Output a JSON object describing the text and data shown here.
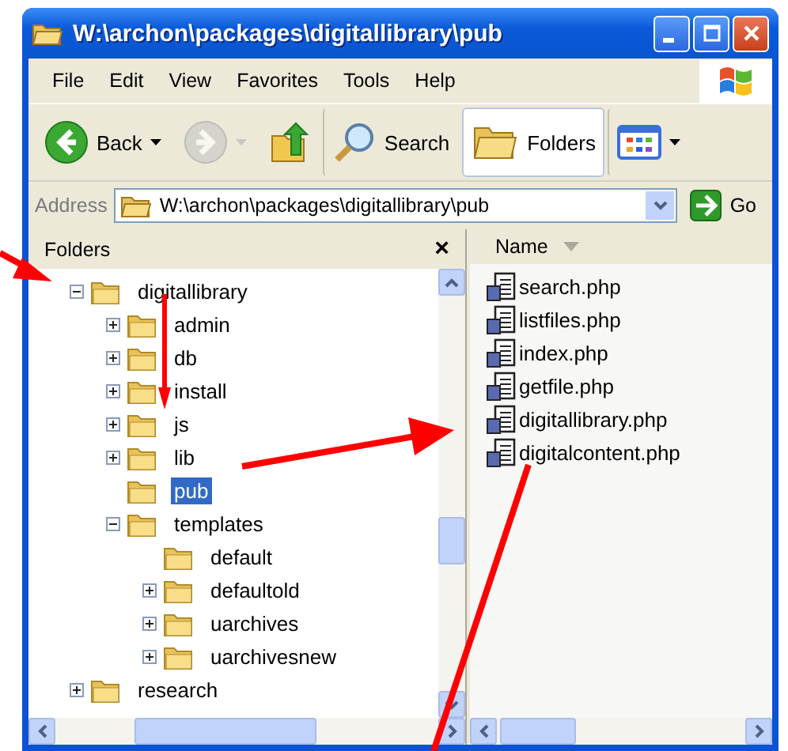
{
  "window": {
    "title": "W:\\archon\\packages\\digitallibrary\\pub"
  },
  "menu": [
    "File",
    "Edit",
    "View",
    "Favorites",
    "Tools",
    "Help"
  ],
  "toolbar": [
    {
      "kind": "back",
      "label": "Back",
      "pressed": false,
      "disabled": false
    },
    {
      "kind": "forward",
      "pressed": false,
      "disabled": true
    },
    {
      "kind": "up",
      "pressed": false,
      "disabled": false
    },
    {
      "kind": "search",
      "label": "Search",
      "pressed": false,
      "disabled": false
    },
    {
      "kind": "folders",
      "label": "Folders",
      "pressed": true,
      "disabled": false
    },
    {
      "kind": "views",
      "pressed": false,
      "disabled": false
    }
  ],
  "address": {
    "label": "Address",
    "value": "W:\\archon\\packages\\digitallibrary\\pub",
    "go": "Go"
  },
  "folders_pane": {
    "title": "Folders",
    "close": "×",
    "tree": [
      {
        "label": "digitallibrary",
        "expanded": true,
        "selected": false,
        "children": [
          {
            "label": "admin",
            "expanded": false,
            "selected": false
          },
          {
            "label": "db",
            "expanded": false,
            "selected": false
          },
          {
            "label": "install",
            "expanded": false,
            "selected": false
          },
          {
            "label": "js",
            "expanded": false,
            "selected": false
          },
          {
            "label": "lib",
            "expanded": false,
            "selected": false
          },
          {
            "label": "pub",
            "selected": true
          },
          {
            "label": "templates",
            "expanded": true,
            "selected": false,
            "children": [
              {
                "label": "default",
                "selected": false
              },
              {
                "label": "defaultold",
                "expanded": false,
                "selected": false
              },
              {
                "label": "uarchives",
                "expanded": false,
                "selected": false
              },
              {
                "label": "uarchivesnew",
                "expanded": false,
                "selected": false
              }
            ]
          }
        ]
      },
      {
        "label": "research",
        "expanded": false,
        "selected": false
      }
    ]
  },
  "file_list": {
    "columns": [
      "Name"
    ],
    "files": [
      "search.php",
      "listfiles.php",
      "index.php",
      "getfile.php",
      "digitallibrary.php",
      "digitalcontent.php"
    ]
  }
}
